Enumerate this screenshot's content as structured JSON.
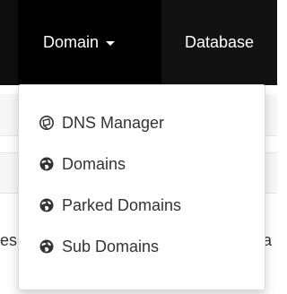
{
  "navbar": {
    "items": [
      {
        "label": "Domain"
      },
      {
        "label": "Database"
      }
    ]
  },
  "dropdown": {
    "items": [
      {
        "label": "DNS Manager",
        "icon": "dns-icon"
      },
      {
        "label": "Domains",
        "icon": "globe-icon"
      },
      {
        "label": "Parked Domains",
        "icon": "globe-icon"
      },
      {
        "label": "Sub Domains",
        "icon": "globe-icon"
      }
    ]
  },
  "background": {
    "left_fragment": "es",
    "right_fragment": "a"
  },
  "colors": {
    "navbar": "#121212",
    "active_nav": "#000000",
    "menu_text": "#333333"
  }
}
